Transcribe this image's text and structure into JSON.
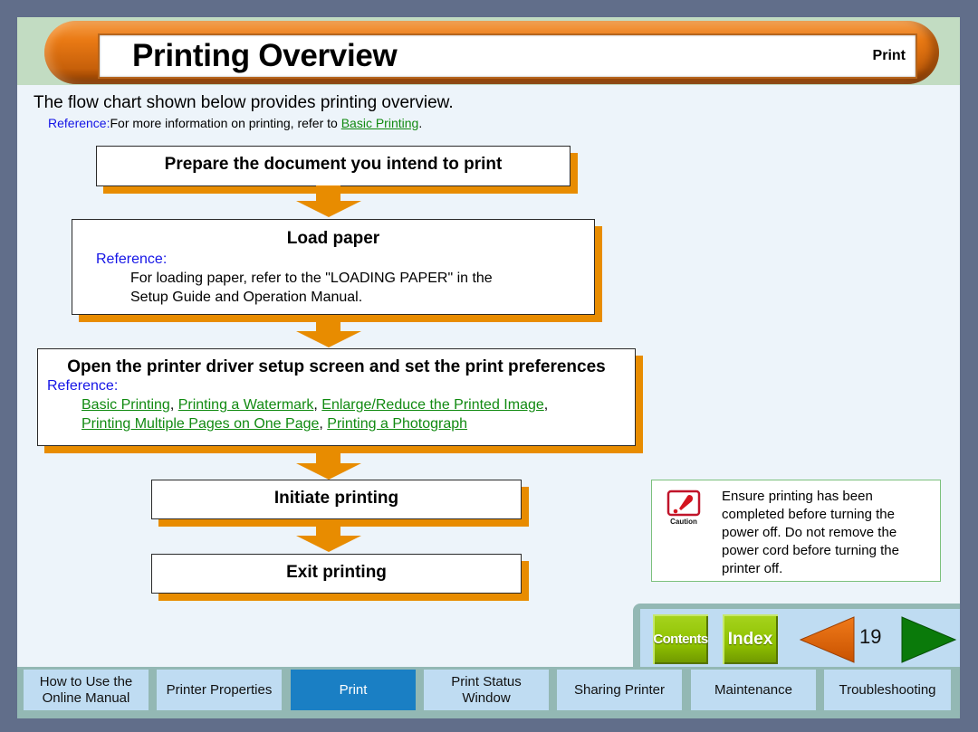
{
  "header": {
    "title": "Printing Overview",
    "section": "Print"
  },
  "intro": {
    "text": "The flow chart shown below provides printing overview.",
    "reference_label": "Reference:",
    "reference_text": "For more information on printing, refer to ",
    "reference_link": "Basic Printing",
    "reference_end": "."
  },
  "flow": {
    "step1": {
      "title": "Prepare the document you intend to print"
    },
    "step2": {
      "title": "Load paper",
      "reference_label": "Reference:",
      "body_line1": "For loading paper, refer to the \"LOADING PAPER\" in the",
      "body_line2": "Setup Guide and Operation Manual."
    },
    "step3": {
      "title": "Open the printer driver setup screen and set the print preferences",
      "reference_label": "Reference:",
      "links": [
        "Basic Printing",
        "Printing a Watermark",
        "Enlarge/Reduce the Printed Image",
        "Printing Multiple Pages on One Page",
        "Printing a Photograph"
      ],
      "separator": ", "
    },
    "step4": {
      "title": "Initiate printing"
    },
    "step5": {
      "title": "Exit printing"
    },
    "arrow_color": "#e88c00"
  },
  "caution": {
    "icon": "caution-icon",
    "icon_label": "Caution",
    "text": "Ensure printing has been completed before turning the power off. Do not remove the power cord before turning the printer off."
  },
  "nav": {
    "contents_label": "Contents",
    "index_label": "Index",
    "page_number": "19",
    "prev_icon": "prev-page-triangle",
    "next_icon": "next-page-triangle"
  },
  "tabs": [
    {
      "label": "How to Use the Online Manual",
      "active": false
    },
    {
      "label": "Printer Properties",
      "active": false
    },
    {
      "label": "Print",
      "active": true
    },
    {
      "label": "Print Status Window",
      "active": false
    },
    {
      "label": "Sharing Printer",
      "active": false
    },
    {
      "label": "Maintenance",
      "active": false
    },
    {
      "label": "Troubleshooting",
      "active": false
    }
  ],
  "colors": {
    "accent_orange": "#e88c00",
    "active_tab": "#1a7fc4",
    "tab_bg": "#bfdcf2",
    "link_green": "#118a11",
    "reference_blue": "#1414e6",
    "button_green": "#8fc100"
  }
}
